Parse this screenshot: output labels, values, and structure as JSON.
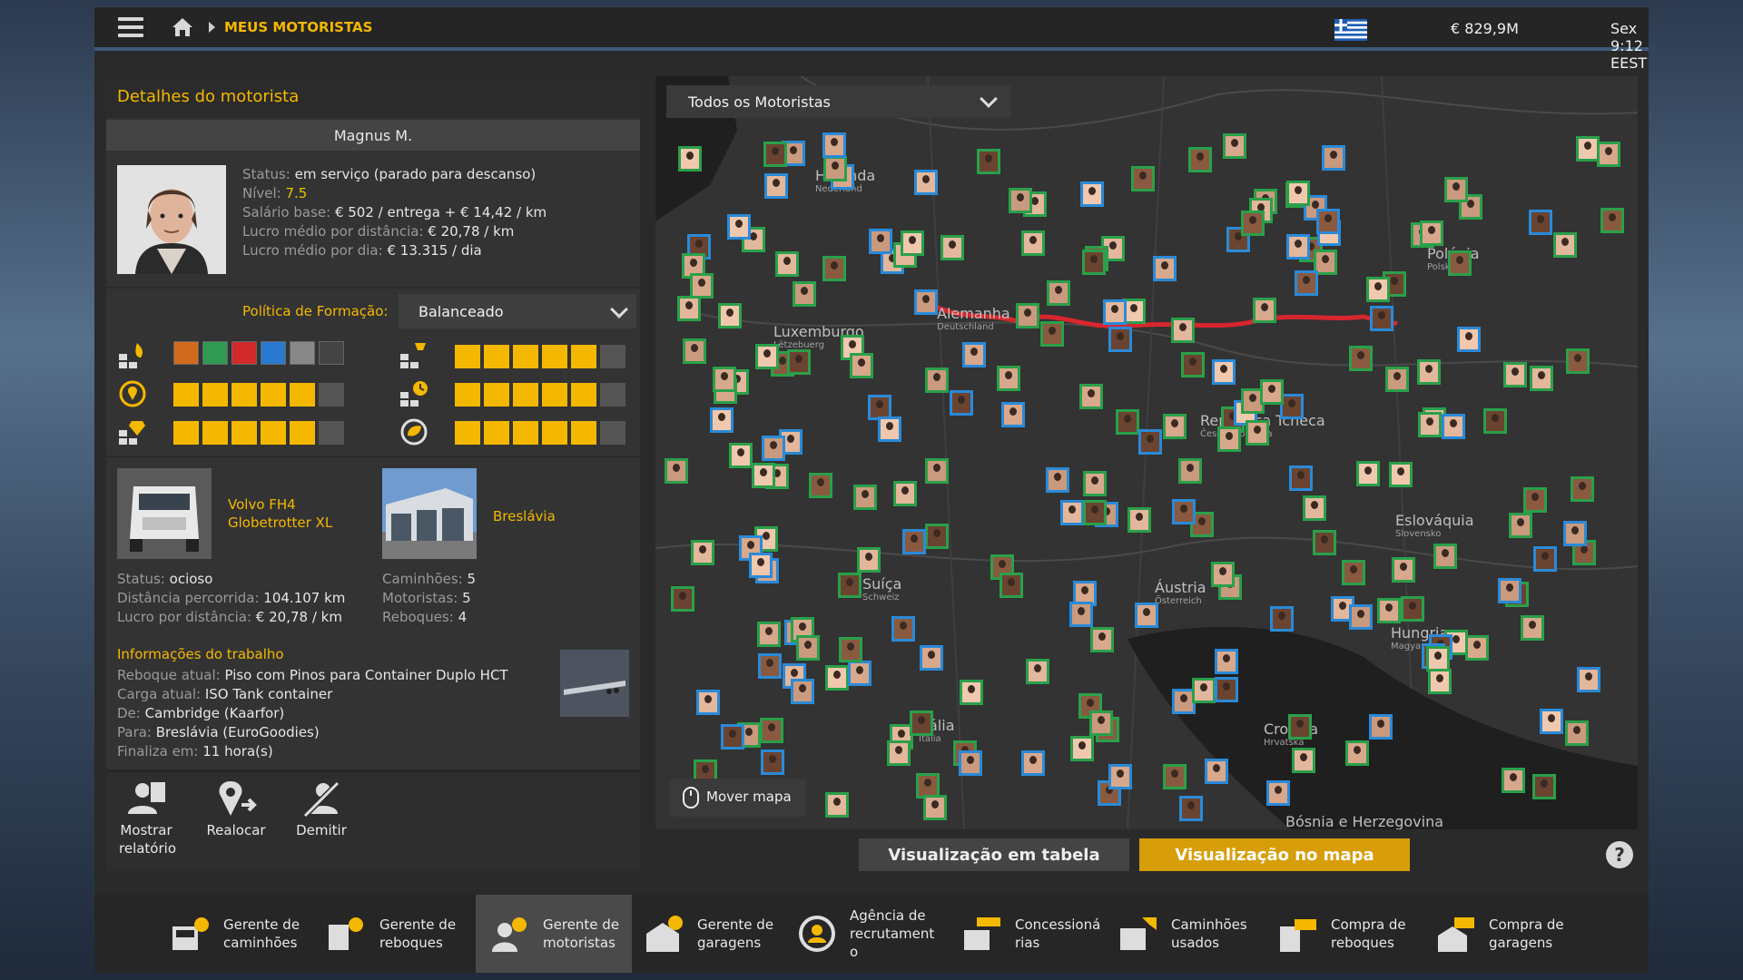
{
  "topbar": {
    "breadcrumb": "MEUS MOTORISTAS",
    "money": "€ 829,9M",
    "clock": "Sex 9:12 EEST"
  },
  "driver_panel": {
    "title": "Detalhes do motorista",
    "name": "Magnus M.",
    "status_label": "Status:",
    "status_value": "em serviço (parado para descanso)",
    "level_label": "Nível:",
    "level_value": "7.5",
    "salary_label": "Salário base:",
    "salary_value": "€ 502 / entrega + € 14,42 / km",
    "avg_dist_label": "Lucro médio por distância:",
    "avg_dist_value": "€ 20,78 / km",
    "avg_day_label": "Lucro médio por dia:",
    "avg_day_value": "€ 13.315 / dia",
    "policy_label": "Política de Formação:",
    "policy_value": "Balanceado",
    "skills": {
      "long_distance": 5,
      "high_value_cargo": 5,
      "fragile_cargo": 5,
      "fuel_efficiency": 5,
      "just_in_time": 5,
      "cargo_types_count": 6
    },
    "truck": {
      "name_line1": "Volvo FH4",
      "name_line2": "Globetrotter XL",
      "status_label": "Status:",
      "status_value": "ocioso",
      "distance_label": "Distância percorrida:",
      "distance_value": "104.107 km",
      "profit_label": "Lucro por distância:",
      "profit_value": "€ 20,78 / km"
    },
    "garage": {
      "name": "Breslávia",
      "trucks_label": "Caminhões:",
      "trucks_value": "5",
      "drivers_label": "Motoristas:",
      "drivers_value": "5",
      "trailers_label": "Reboques:",
      "trailers_value": "4"
    },
    "job": {
      "title": "Informações do trabalho",
      "trailer_label": "Reboque atual:",
      "trailer_value": "Piso com Pinos para Container Duplo HCT",
      "cargo_label": "Carga atual:",
      "cargo_value": "ISO Tank container",
      "from_label": "De:",
      "from_value": "Cambridge (Kaarfor)",
      "to_label": "Para:",
      "to_value": "Breslávia (EuroGoodies)",
      "ends_label": "Finaliza em:",
      "ends_value": "11 hora(s)"
    },
    "actions": {
      "report_l1": "Mostrar",
      "report_l2": "relatório",
      "relocate": "Realocar",
      "fire": "Demitir"
    }
  },
  "map": {
    "filter": "Todos os Motoristas",
    "move_map": "Mover mapa",
    "cities": [
      {
        "name": "Holanda",
        "sub": "Nederland"
      },
      {
        "name": "Luxemburgo",
        "sub": "Lëtzebuerg"
      },
      {
        "name": "Alemanha",
        "sub": "Deutschland"
      },
      {
        "name": "Polónia",
        "sub": "Polska"
      },
      {
        "name": "República Tcheca",
        "sub": "Česká republika"
      },
      {
        "name": "Eslováquia",
        "sub": "Slovensko"
      },
      {
        "name": "Suíça",
        "sub": "Schweiz"
      },
      {
        "name": "Áustria",
        "sub": "Österreich"
      },
      {
        "name": "Hungria",
        "sub": "Magyarország"
      },
      {
        "name": "Itália",
        "sub": "Italia"
      },
      {
        "name": "Croácia",
        "sub": "Hrvatska"
      },
      {
        "name": "Bósnia e Herzegovina",
        "sub": ""
      }
    ]
  },
  "view_buttons": {
    "table": "Visualização em tabela",
    "map": "Visualização no mapa",
    "help": "?"
  },
  "nav": [
    {
      "l1": "Gerente de",
      "l2": "caminhões",
      "l3": ""
    },
    {
      "l1": "Gerente de",
      "l2": "reboques",
      "l3": ""
    },
    {
      "l1": "Gerente de",
      "l2": "motoristas",
      "l3": ""
    },
    {
      "l1": "Gerente de",
      "l2": "garagens",
      "l3": ""
    },
    {
      "l1": "Agência de",
      "l2": "recrutament",
      "l3": "o"
    },
    {
      "l1": "Concessioná",
      "l2": "rias",
      "l3": ""
    },
    {
      "l1": "Caminhões",
      "l2": "usados",
      "l3": ""
    },
    {
      "l1": "Compra de",
      "l2": "reboques",
      "l3": ""
    },
    {
      "l1": "Compra de",
      "l2": "garagens",
      "l3": ""
    }
  ],
  "colors": {
    "accent": "#f5b800",
    "own_driver": "#2aa04a",
    "other_driver": "#2a8ad8",
    "route": "#d8262e"
  }
}
